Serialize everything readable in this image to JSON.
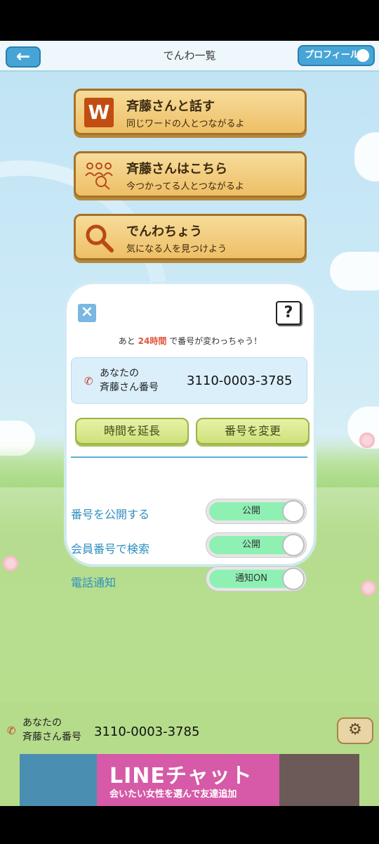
{
  "header": {
    "title": "でんわ一覧",
    "back_icon": "←",
    "profile_label": "プロフィール"
  },
  "menu": [
    {
      "icon_text": "W",
      "title": "斉藤さんと話す",
      "subtitle": "同じワードの人とつながるよ"
    },
    {
      "icon_text": "",
      "title": "斉藤さんはこちら",
      "subtitle": "今つかってる人とつながるよ"
    },
    {
      "icon_text": "",
      "title": "でんわちょう",
      "subtitle": "気になる人を見つけよう"
    }
  ],
  "modal": {
    "notice_pre": "あと",
    "notice_highlight": "24時間",
    "notice_post": "で番号が変わっちゃう！",
    "number_label_line1": "あなたの",
    "number_label_line2": "斉藤さん番号",
    "number": "3110-0003-3785",
    "extend_button": "時間を延長",
    "change_button": "番号を変更",
    "settings": [
      {
        "label": "番号を公開する",
        "state": "公開"
      },
      {
        "label": "会員番号で検索",
        "state": "公開"
      },
      {
        "label": "電話通知",
        "state": "通知ON"
      }
    ]
  },
  "bottom": {
    "number_label_line1": "あなたの",
    "number_label_line2": "斉藤さん番号",
    "number": "3110-0003-3785"
  },
  "ad": {
    "title": "LINEチャット",
    "subtitle": "会いたい女性を選んで友達追加"
  },
  "colors": {
    "accent": "#46a5d6",
    "card": "#eebf66",
    "toggle_on": "#8ff0b4",
    "highlight": "#e0563d"
  }
}
